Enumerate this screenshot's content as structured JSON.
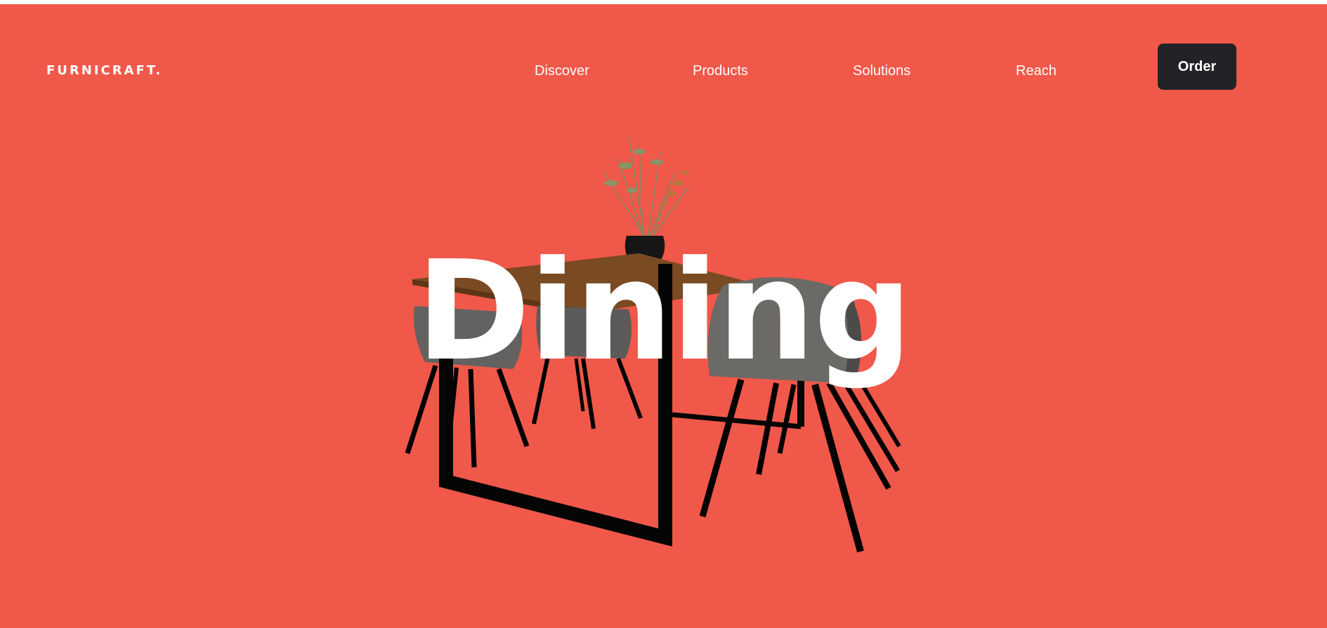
{
  "header": {
    "logo": "FURNICRAFT.",
    "nav": [
      {
        "label": "Discover"
      },
      {
        "label": "Products"
      },
      {
        "label": "Solutions"
      },
      {
        "label": "Reach"
      }
    ],
    "cta_label": "Order"
  },
  "hero": {
    "title": "Dining",
    "image_icon": "dining-table-with-chairs-illustration"
  },
  "colors": {
    "background": "#f0584a",
    "cta_background": "#222327",
    "text": "#ffffff"
  }
}
